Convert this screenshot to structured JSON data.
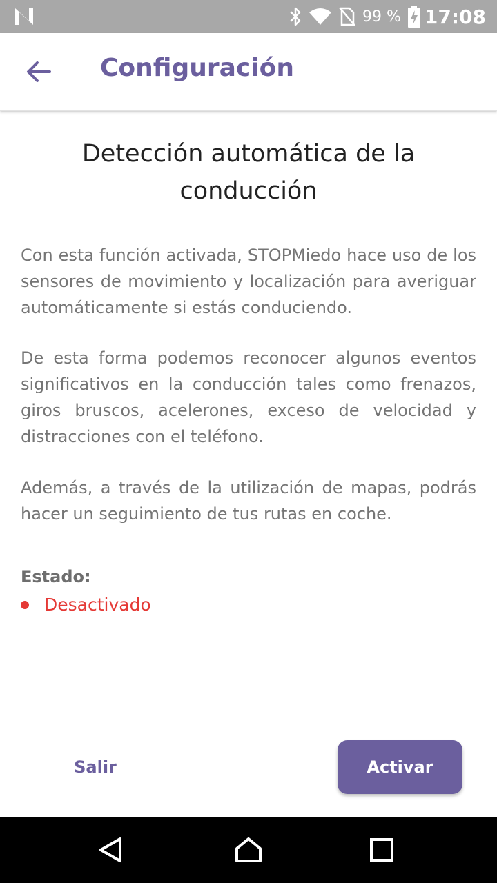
{
  "status_bar": {
    "battery_percent": "99 %",
    "time": "17:08",
    "icons": [
      "n-logo-icon",
      "bluetooth-icon",
      "wifi-icon",
      "no-sim-icon",
      "battery-charging-icon"
    ]
  },
  "app_bar": {
    "title": "Configuración",
    "back_icon": "arrow-left-icon"
  },
  "content": {
    "heading": "Detección automática de la conducción",
    "paragraphs": [
      "Con esta función activada, STOPMiedo hace uso de los sensores de movimiento y localización para averiguar automáticamente si estás conduciendo.",
      "De esta forma podemos reconocer algunos eventos significativos en la conducción tales como frenazos, giros bruscos, acelerones, exceso de velocidad y distracciones con el teléfono.",
      "Además, a través de la utilización de mapas, podrás hacer un seguimiento de tus rutas en coche."
    ],
    "status_label": "Estado:",
    "status_value": "Desactivado"
  },
  "buttons": {
    "exit_label": "Salir",
    "activate_label": "Activar"
  },
  "colors": {
    "accent": "#6b5f9e",
    "status_off": "#e53935",
    "status_bar": "#a8a8a8"
  },
  "nav_bar": {
    "icons": [
      "nav-back-icon",
      "nav-home-icon",
      "nav-recent-icon"
    ]
  }
}
